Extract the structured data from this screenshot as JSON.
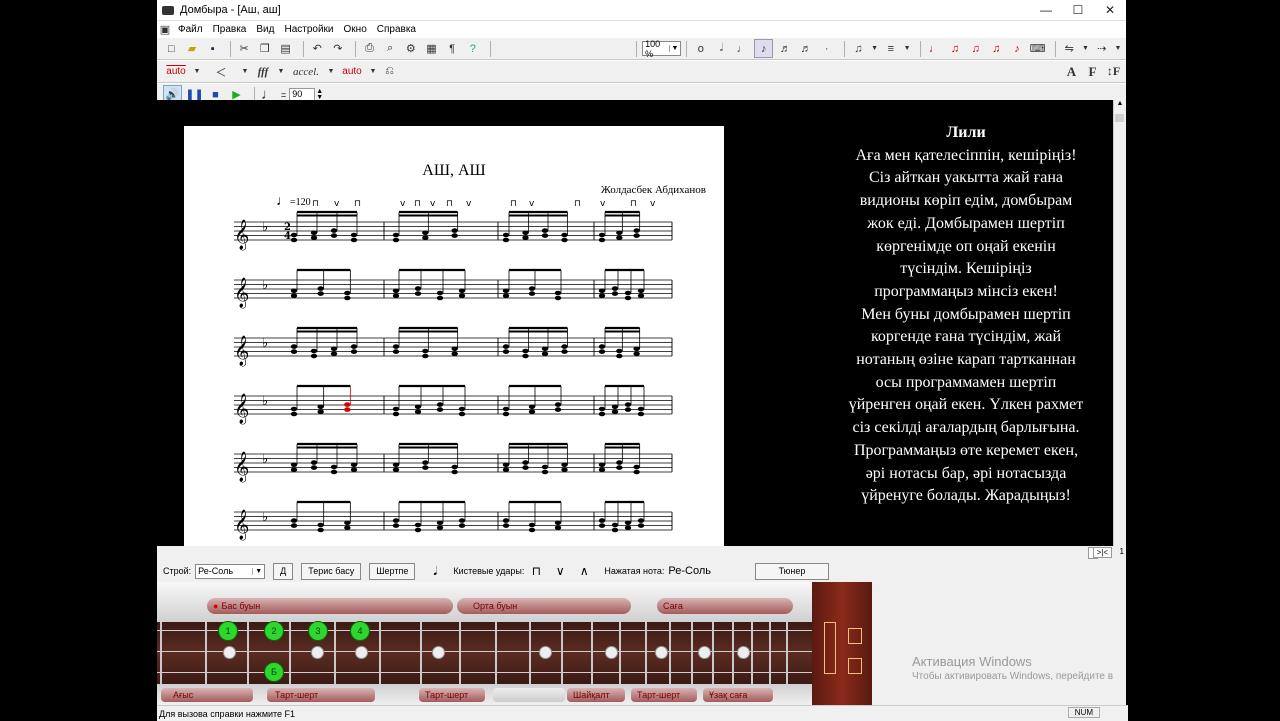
{
  "window": {
    "title": "Домбыра - [Аш, аш]",
    "controls": [
      "—",
      "☐",
      "✕"
    ]
  },
  "menu": [
    "Файл",
    "Правка",
    "Вид",
    "Настройки",
    "Окно",
    "Справка"
  ],
  "toolbar": {
    "zoom": "100 %",
    "format_buttons": [
      "A",
      "F",
      "↕F"
    ]
  },
  "toolbar2": {
    "auto_label": "auto",
    "accel_label": "accel.",
    "fff_label": "fff"
  },
  "playback": {
    "tempo": "90"
  },
  "score": {
    "title": "АШ, АШ",
    "composer": "Жолдасбек Абдиханов",
    "tempo_marking": "=120",
    "staff_count": 6,
    "highlighted_note_color": "#d40000"
  },
  "lyrics": {
    "title": "Лили",
    "lines": [
      "Аға мен қателесіппін, кешіріңіз!",
      "Сіз айткан уакытта жай ғана",
      "видионы көріп едім, домбырам",
      "жок еді. Домбырамен шертіп",
      "көргенімде оп оңай екенін",
      "түсіндім. Кешіріңіз",
      "программаңыз мінсіз екен!",
      "Мен буны домбырамен шертіп",
      "коргенде ғана түсіндім, жай",
      "нотаның өзіне карап тартканнан",
      "осы программамен шертіп",
      "үйренген оңай екен. Үлкен рахмет",
      "сіз секілді ағалардың барлығына.",
      "Программаңыз өте керемет екен,",
      "әрі нотасы бар, әрі нотасызда",
      "үйренуге болады. Жарадыңыз!"
    ]
  },
  "hscroll": {
    "mini1": ">|<",
    "mini2": "1"
  },
  "controls": {
    "stroy_label": "Строй:",
    "stroy_value": "Ре-Соль",
    "d_button": "Д",
    "teris_button": "Терис басу",
    "shertpe_button": "Шертпе",
    "strokes_label": "Кистевые удары:",
    "pressed_label": "Нажатая нота:",
    "pressed_value": "Ре-Соль",
    "tuner_button": "Тюнер"
  },
  "dombyra": {
    "pills_top": [
      "Бас буын",
      "Орта буын",
      "Саға"
    ],
    "pills_bottom": [
      "Ағыс",
      "Тарт-шерт",
      "Тарт-шерт",
      "Шайқалт",
      "Тарт-шерт",
      "Ұзақ саға"
    ],
    "finger_dots": [
      "1",
      "2",
      "3",
      "4"
    ],
    "lower_dot": "Б"
  },
  "status": {
    "help": "Для вызова справки нажмите F1",
    "num": "NUM"
  },
  "activation": {
    "title": "Активация Windows",
    "subtitle": "Чтобы активировать Windows, перейдите в"
  }
}
